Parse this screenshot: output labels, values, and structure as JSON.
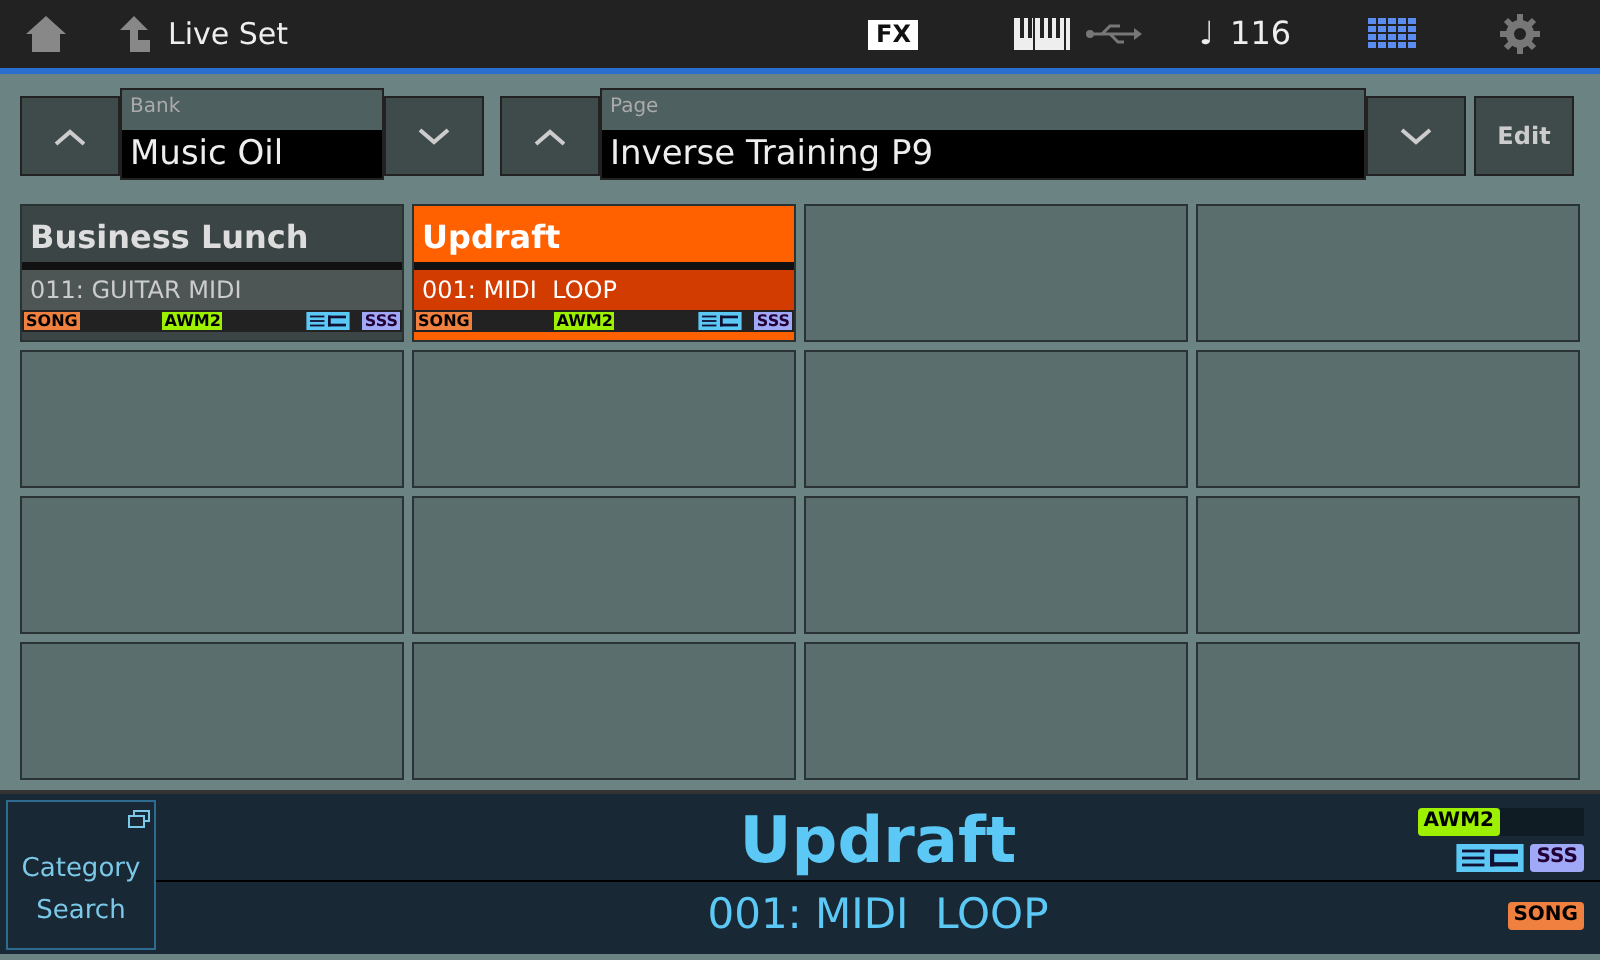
{
  "top_bar": {
    "title": "Live Set",
    "fx": "FX",
    "note": "♩",
    "tempo": "116"
  },
  "bank": {
    "label": "Bank",
    "value": "Music Oil"
  },
  "page": {
    "label": "Page",
    "value": "Inverse Training P9"
  },
  "edit_button": "Edit",
  "slots": [
    {
      "kind": "performance",
      "selected": false,
      "name": "Business Lunch",
      "sub": "011: GUITAR MIDI",
      "song": "SONG",
      "awm": "AWM2",
      "sss": "SSS"
    },
    {
      "kind": "performance",
      "selected": true,
      "name": "Updraft",
      "sub": "001: MIDI  LOOP",
      "song": "SONG",
      "awm": "AWM2",
      "sss": "SSS"
    },
    {
      "kind": "empty"
    },
    {
      "kind": "empty"
    },
    {
      "kind": "empty"
    },
    {
      "kind": "empty"
    },
    {
      "kind": "empty"
    },
    {
      "kind": "empty"
    },
    {
      "kind": "empty"
    },
    {
      "kind": "empty"
    },
    {
      "kind": "empty"
    },
    {
      "kind": "empty"
    },
    {
      "kind": "empty"
    },
    {
      "kind": "empty"
    },
    {
      "kind": "empty"
    },
    {
      "kind": "empty"
    }
  ],
  "bottom": {
    "category_button": "Category Search",
    "name": "Updraft",
    "sub": "001: MIDI  LOOP",
    "awm": "AWM2",
    "sss": "SSS",
    "song": "SONG"
  }
}
